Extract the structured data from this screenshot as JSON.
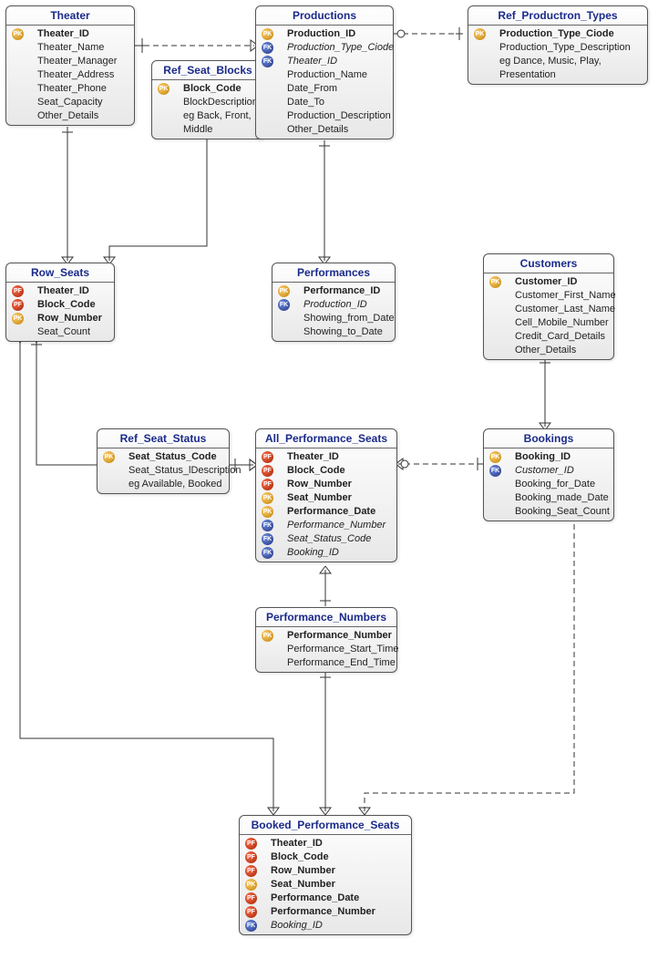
{
  "entities": {
    "theater": {
      "title": "Theater",
      "rows": [
        {
          "keys": [
            "pk"
          ],
          "name": "Theater_ID",
          "bold": true
        },
        {
          "keys": [],
          "name": "Theater_Name"
        },
        {
          "keys": [],
          "name": "Theater_Manager"
        },
        {
          "keys": [],
          "name": "Theater_Address"
        },
        {
          "keys": [],
          "name": "Theater_Phone"
        },
        {
          "keys": [],
          "name": "Seat_Capacity"
        },
        {
          "keys": [],
          "name": "Other_Details"
        }
      ]
    },
    "ref_seat_blocks": {
      "title": "Ref_Seat_Blocks",
      "rows": [
        {
          "keys": [
            "pk"
          ],
          "name": "Block_Code",
          "bold": true
        },
        {
          "keys": [],
          "name": "BlockDescription"
        },
        {
          "keys": [],
          "name": "eg Back, Front, Middle"
        }
      ]
    },
    "productions": {
      "title": "Productions",
      "rows": [
        {
          "keys": [
            "pk"
          ],
          "name": "Production_ID",
          "bold": true
        },
        {
          "keys": [
            "fk"
          ],
          "name": "Production_Type_Ciode",
          "italic": true
        },
        {
          "keys": [
            "fk"
          ],
          "name": "Theater_ID",
          "italic": true
        },
        {
          "keys": [],
          "name": "Production_Name"
        },
        {
          "keys": [],
          "name": "Date_From"
        },
        {
          "keys": [],
          "name": "Date_To"
        },
        {
          "keys": [],
          "name": "Production_Description"
        },
        {
          "keys": [],
          "name": "Other_Details"
        }
      ]
    },
    "ref_production_types": {
      "title": "Ref_Productron_Types",
      "rows": [
        {
          "keys": [
            "pk"
          ],
          "name": "Production_Type_Ciode",
          "bold": true
        },
        {
          "keys": [],
          "name": "Production_Type_Description"
        },
        {
          "keys": [],
          "name": "eg Dance, Music, Play, Presentation"
        }
      ]
    },
    "row_seats": {
      "title": "Row_Seats",
      "rows": [
        {
          "keys": [
            "pf"
          ],
          "name": "Theater_ID",
          "bold": true
        },
        {
          "keys": [
            "pf"
          ],
          "name": "Block_Code",
          "bold": true
        },
        {
          "keys": [
            "pk"
          ],
          "name": "Row_Number",
          "bold": true
        },
        {
          "keys": [],
          "name": "Seat_Count"
        }
      ]
    },
    "performances": {
      "title": "Performances",
      "rows": [
        {
          "keys": [
            "pk"
          ],
          "name": "Performance_ID",
          "bold": true
        },
        {
          "keys": [
            "fk"
          ],
          "name": "Production_ID",
          "italic": true
        },
        {
          "keys": [],
          "name": "Showing_from_Date"
        },
        {
          "keys": [],
          "name": "Showing_to_Date"
        }
      ]
    },
    "customers": {
      "title": "Customers",
      "rows": [
        {
          "keys": [
            "pk"
          ],
          "name": "Customer_ID",
          "bold": true
        },
        {
          "keys": [],
          "name": "Customer_First_Name"
        },
        {
          "keys": [],
          "name": "Customer_Last_Name"
        },
        {
          "keys": [],
          "name": "Cell_Mobile_Number"
        },
        {
          "keys": [],
          "name": "Credit_Card_Details"
        },
        {
          "keys": [],
          "name": "Other_Details"
        }
      ]
    },
    "ref_seat_status": {
      "title": "Ref_Seat_Status",
      "rows": [
        {
          "keys": [
            "pk"
          ],
          "name": "Seat_Status_Code",
          "bold": true
        },
        {
          "keys": [],
          "name": "Seat_Status_lDescription"
        },
        {
          "keys": [],
          "name": "eg Available, Booked"
        }
      ]
    },
    "all_performance_seats": {
      "title": "All_Performance_Seats",
      "rows": [
        {
          "keys": [
            "pf"
          ],
          "name": "Theater_ID",
          "bold": true
        },
        {
          "keys": [
            "pf"
          ],
          "name": "Block_Code",
          "bold": true
        },
        {
          "keys": [
            "pf"
          ],
          "name": "Row_Number",
          "bold": true
        },
        {
          "keys": [
            "pk"
          ],
          "name": "Seat_Number",
          "bold": true
        },
        {
          "keys": [
            "pk"
          ],
          "name": "Performance_Date",
          "bold": true
        },
        {
          "keys": [
            "fk"
          ],
          "name": "Performance_Number",
          "italic": true
        },
        {
          "keys": [
            "fk"
          ],
          "name": "Seat_Status_Code",
          "italic": true
        },
        {
          "keys": [
            "fk"
          ],
          "name": "Booking_ID",
          "italic": true
        }
      ]
    },
    "bookings": {
      "title": "Bookings",
      "rows": [
        {
          "keys": [
            "pk"
          ],
          "name": "Booking_ID",
          "bold": true
        },
        {
          "keys": [
            "fk"
          ],
          "name": "Customer_ID",
          "italic": true
        },
        {
          "keys": [],
          "name": "Booking_for_Date"
        },
        {
          "keys": [],
          "name": "Booking_made_Date"
        },
        {
          "keys": [],
          "name": "Booking_Seat_Count"
        }
      ]
    },
    "performance_numbers": {
      "title": "Performance_Numbers",
      "rows": [
        {
          "keys": [
            "pk"
          ],
          "name": "Performance_Number",
          "bold": true
        },
        {
          "keys": [],
          "name": "Performance_Start_Time"
        },
        {
          "keys": [],
          "name": "Performance_End_Time"
        }
      ]
    },
    "booked_performance_seats": {
      "title": "Booked_Performance_Seats",
      "rows": [
        {
          "keys": [
            "pf"
          ],
          "name": "Theater_ID",
          "bold": true
        },
        {
          "keys": [
            "pf"
          ],
          "name": "Block_Code",
          "bold": true
        },
        {
          "keys": [
            "pf"
          ],
          "name": "Row_Number",
          "bold": true
        },
        {
          "keys": [
            "pk"
          ],
          "name": " Seat_Number",
          "bold": true
        },
        {
          "keys": [
            "pf"
          ],
          "name": "Performance_Date",
          "bold": true
        },
        {
          "keys": [
            "pf"
          ],
          "name": "Performance_Number",
          "bold": true
        },
        {
          "keys": [
            "fk"
          ],
          "name": "Booking_ID",
          "italic": true
        }
      ]
    }
  },
  "keyLabels": {
    "pk": "PK",
    "fk": "FK",
    "pf": "PF"
  }
}
